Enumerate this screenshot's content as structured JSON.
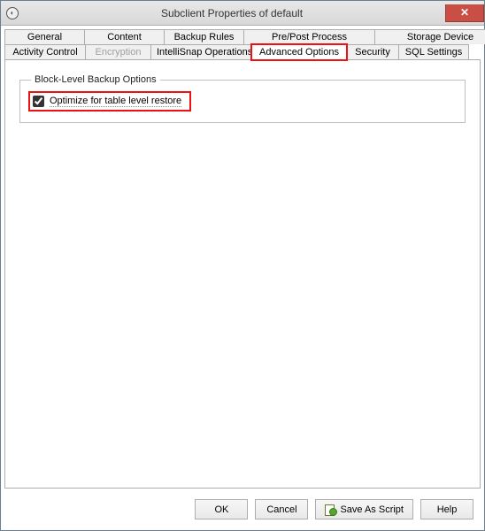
{
  "window": {
    "title": "Subclient Properties of default"
  },
  "tabs": {
    "row1": [
      {
        "label": "General"
      },
      {
        "label": "Content"
      },
      {
        "label": "Backup Rules"
      },
      {
        "label": "Pre/Post Process"
      },
      {
        "label": "Storage Device"
      }
    ],
    "row2": [
      {
        "label": "Activity Control"
      },
      {
        "label": "Encryption"
      },
      {
        "label": "IntelliSnap Operations"
      },
      {
        "label": "Advanced Options"
      },
      {
        "label": "Security"
      },
      {
        "label": "SQL Settings"
      }
    ]
  },
  "group": {
    "legend": "Block-Level Backup Options",
    "checkbox_label": "Optimize for table level restore",
    "checkbox_checked": true
  },
  "buttons": {
    "ok": "OK",
    "cancel": "Cancel",
    "save_script": "Save As Script",
    "help": "Help"
  }
}
